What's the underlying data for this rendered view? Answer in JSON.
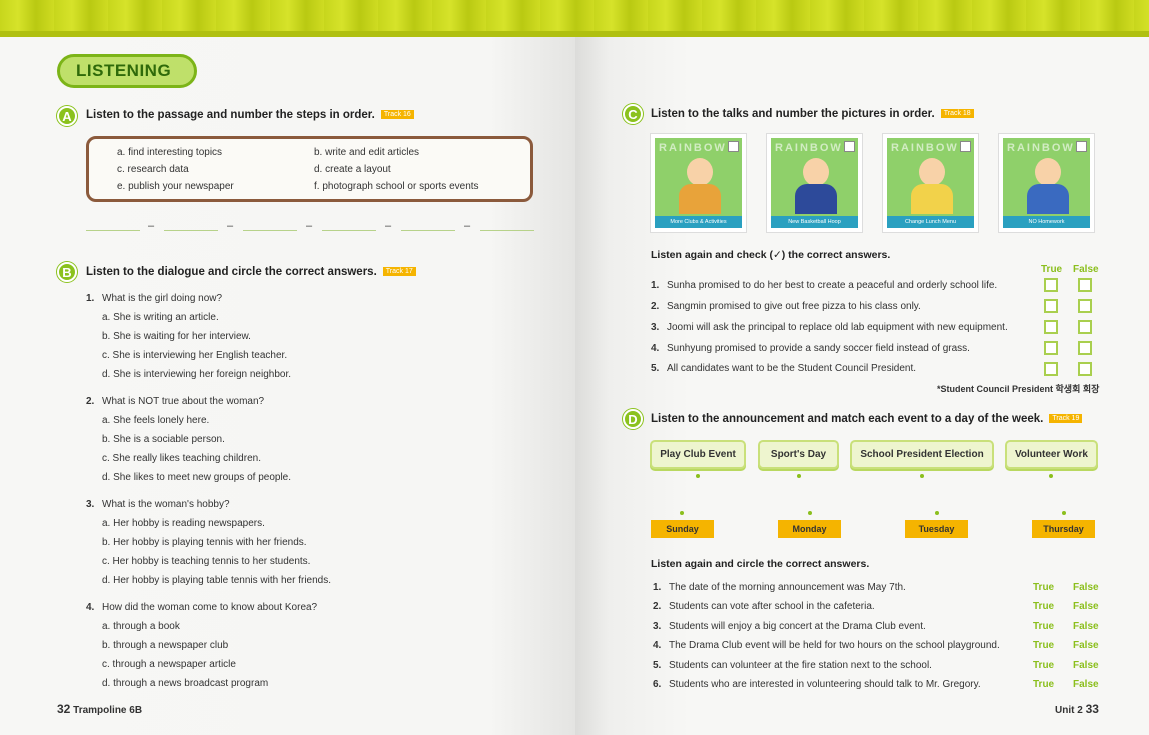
{
  "left_page": {
    "header": "LISTENING",
    "A": {
      "badge": "A",
      "instruction": "Listen to the passage and number the steps in order.",
      "track": "Track 16",
      "steps": [
        "a. find interesting topics",
        "b. write and edit articles",
        "c. research data",
        "d. create a layout",
        "e. publish your newspaper",
        "f. photograph school or sports events"
      ],
      "dash": "–"
    },
    "B": {
      "badge": "B",
      "instruction": "Listen to the dialogue and circle the correct answers.",
      "track": "Track 17",
      "questions": [
        {
          "num": "1.",
          "text": "What is the girl doing now?",
          "options": [
            "a. She is writing an article.",
            "b. She is waiting for her interview.",
            "c. She is interviewing her English teacher.",
            "d. She is interviewing her foreign neighbor."
          ]
        },
        {
          "num": "2.",
          "text": "What is NOT true about the woman?",
          "options": [
            "a. She feels lonely here.",
            "b. She is a sociable person.",
            "c. She really likes teaching children.",
            "d. She likes to meet new groups of people."
          ]
        },
        {
          "num": "3.",
          "text": "What is the woman's hobby?",
          "options": [
            "a. Her hobby is reading newspapers.",
            "b. Her hobby is playing tennis with her friends.",
            "c. Her hobby is teaching tennis to her students.",
            "d. Her hobby is playing table tennis with her friends."
          ]
        },
        {
          "num": "4.",
          "text": "How did the woman come to know about Korea?",
          "options": [
            "a. through a book",
            "b. through a newspaper club",
            "c. through a newspaper article",
            "d. through a news broadcast program"
          ]
        }
      ]
    },
    "footer": {
      "page": "32",
      "book": "Trampoline 6B"
    }
  },
  "right_page": {
    "C": {
      "badge": "C",
      "instruction": "Listen to the talks and number the pictures in order.",
      "track": "Track 18",
      "pictures": [
        "More Clubs & Activities",
        "New Basketball Hoop",
        "Change Lunch Menu",
        "NO Homework"
      ],
      "sign": "RAINBOW",
      "check_instruction": "Listen again and check (✓) the correct answers.",
      "true_label": "True",
      "false_label": "False",
      "statements": [
        {
          "num": "1.",
          "text": "Sunha promised to do her best to create a peaceful and orderly school life."
        },
        {
          "num": "2.",
          "text": "Sangmin promised to give out free pizza to his class only."
        },
        {
          "num": "3.",
          "text": "Joomi will ask the principal to replace old lab equipment with new equipment."
        },
        {
          "num": "4.",
          "text": "Sunhyung promised to provide a sandy soccer field instead of grass."
        },
        {
          "num": "5.",
          "text": "All candidates want to be the Student Council President."
        }
      ],
      "footnote": "*Student Council President  학생회 회장"
    },
    "D": {
      "badge": "D",
      "instruction": "Listen to the announcement and match each event to a day of the week.",
      "track": "Track 19",
      "events": [
        "Play Club Event",
        "Sport's Day",
        "School President Election",
        "Volunteer Work"
      ],
      "days": [
        "Sunday",
        "Monday",
        "Tuesday",
        "Thursday"
      ],
      "circle_instruction": "Listen again and circle the correct answers.",
      "statements": [
        {
          "num": "1.",
          "text": "The date of the morning announcement was May 7th."
        },
        {
          "num": "2.",
          "text": "Students can vote after school in the cafeteria."
        },
        {
          "num": "3.",
          "text": "Students will enjoy a big concert at the Drama Club event."
        },
        {
          "num": "4.",
          "text": "The Drama Club event will be held for two hours on the school playground."
        },
        {
          "num": "5.",
          "text": "Students can volunteer at the fire station next to the school."
        },
        {
          "num": "6.",
          "text": "Students who are interested in volunteering should talk to Mr. Gregory."
        }
      ],
      "true_label": "True",
      "false_label": "False"
    },
    "footer": {
      "unit": "Unit 2",
      "page": "33"
    }
  },
  "colors": {
    "accent_green": "#8bc21d",
    "track_orange": "#f5b400",
    "box_brown": "#8b5a3c"
  }
}
